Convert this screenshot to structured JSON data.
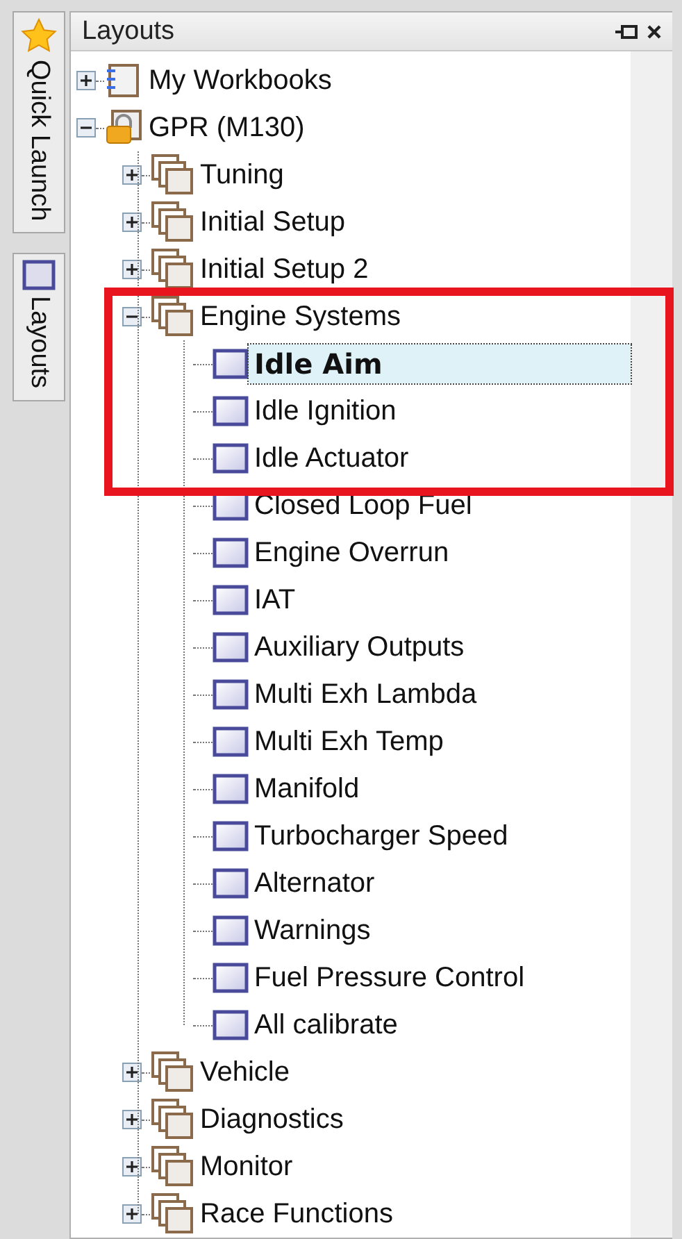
{
  "side_tabs": [
    {
      "label": "Quick Launch",
      "kind": "star"
    },
    {
      "label": "Layouts",
      "kind": "window"
    }
  ],
  "panel": {
    "title": "Layouts"
  },
  "tree": [
    {
      "label": "My Workbooks",
      "kind": "workbook",
      "expanded": false,
      "selected": false,
      "highlighted": false
    },
    {
      "label": "GPR (M130)",
      "kind": "project",
      "expanded": true,
      "selected": false,
      "highlighted": false,
      "children": [
        {
          "label": "Tuning",
          "kind": "group",
          "expanded": false,
          "selected": false,
          "highlighted": false
        },
        {
          "label": "Initial Setup",
          "kind": "group",
          "expanded": false,
          "selected": false,
          "highlighted": false
        },
        {
          "label": "Initial Setup 2",
          "kind": "group",
          "expanded": false,
          "selected": false,
          "highlighted": false
        },
        {
          "label": "Engine Systems",
          "kind": "group",
          "expanded": true,
          "selected": false,
          "highlighted": true,
          "children": [
            {
              "label": "Idle Aim",
              "kind": "layout",
              "selected": true,
              "highlighted": true
            },
            {
              "label": "Idle Ignition",
              "kind": "layout",
              "selected": false,
              "highlighted": true
            },
            {
              "label": "Idle Actuator",
              "kind": "layout",
              "selected": false,
              "highlighted": true
            },
            {
              "label": "Closed Loop Fuel",
              "kind": "layout",
              "selected": false,
              "highlighted": false
            },
            {
              "label": "Engine Overrun",
              "kind": "layout",
              "selected": false,
              "highlighted": false
            },
            {
              "label": "IAT",
              "kind": "layout",
              "selected": false,
              "highlighted": false
            },
            {
              "label": "Auxiliary Outputs",
              "kind": "layout",
              "selected": false,
              "highlighted": false
            },
            {
              "label": "Multi Exh Lambda",
              "kind": "layout",
              "selected": false,
              "highlighted": false
            },
            {
              "label": "Multi Exh Temp",
              "kind": "layout",
              "selected": false,
              "highlighted": false
            },
            {
              "label": "Manifold",
              "kind": "layout",
              "selected": false,
              "highlighted": false
            },
            {
              "label": "Turbocharger Speed",
              "kind": "layout",
              "selected": false,
              "highlighted": false
            },
            {
              "label": "Alternator",
              "kind": "layout",
              "selected": false,
              "highlighted": false
            },
            {
              "label": "Warnings",
              "kind": "layout",
              "selected": false,
              "highlighted": false
            },
            {
              "label": "Fuel Pressure Control",
              "kind": "layout",
              "selected": false,
              "highlighted": false
            },
            {
              "label": "All calibrate",
              "kind": "layout",
              "selected": false,
              "highlighted": false
            }
          ]
        },
        {
          "label": "Vehicle",
          "kind": "group",
          "expanded": false,
          "selected": false,
          "highlighted": false
        },
        {
          "label": "Diagnostics",
          "kind": "group",
          "expanded": false,
          "selected": false,
          "highlighted": false
        },
        {
          "label": "Monitor",
          "kind": "group",
          "expanded": false,
          "selected": false,
          "highlighted": false
        },
        {
          "label": "Race Functions",
          "kind": "group",
          "expanded": false,
          "selected": false,
          "highlighted": false
        }
      ]
    }
  ]
}
